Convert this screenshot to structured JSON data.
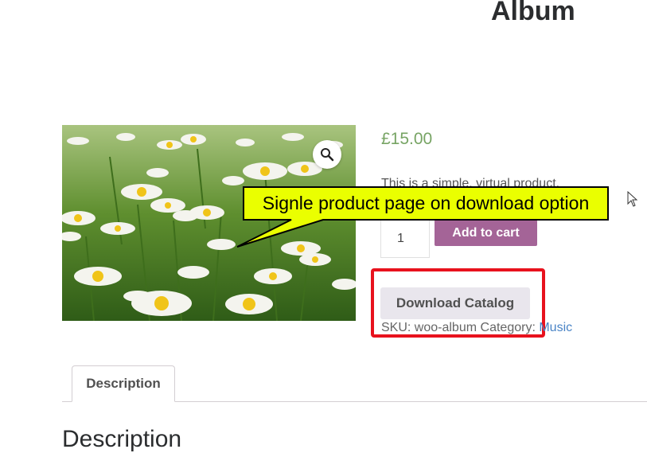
{
  "product": {
    "title": "Album",
    "price": "£15.00",
    "short_description": "This is a simple, virtual product.",
    "quantity": "1",
    "add_to_cart_label": "Add to cart",
    "download_catalog_label": "Download Catalog",
    "meta": {
      "sku_label": "SKU:",
      "sku": "woo-album",
      "category_label": "Category:",
      "category": "Music"
    }
  },
  "tabs": [
    {
      "label": "Description"
    }
  ],
  "section_heading": "Description",
  "annotation": {
    "callout_text": "Signle product page on download option",
    "callout_color": "#eaff00",
    "highlight_color": "#e8121d"
  },
  "icons": {
    "zoom": "magnifier-icon",
    "cursor": "mouse-pointer-icon"
  },
  "colors": {
    "price": "#77a464",
    "add_to_cart": "#a46497",
    "link": "#4a84c6"
  }
}
